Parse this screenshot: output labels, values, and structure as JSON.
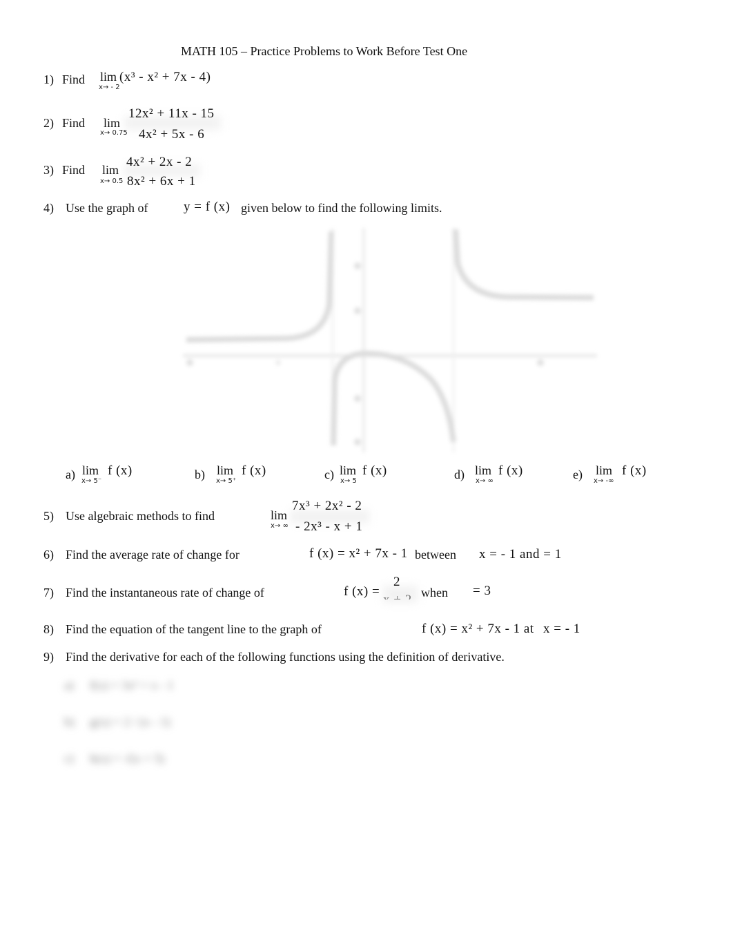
{
  "title": "MATH 105 – Practice Problems to Work Before Test One",
  "problems": {
    "p1": {
      "num": "1)",
      "text": "Find",
      "lim": "lim",
      "sub": "x→ - 2",
      "expr": "(x³ -  x² + 7x - 4)"
    },
    "p2": {
      "num": "2)",
      "text": "Find",
      "lim": "lim",
      "sub": "x→ 0.75",
      "numerator": "12x² + 11x - 15",
      "denominator": "4x² + 5x - 6"
    },
    "p3": {
      "num": "3)",
      "text": "Find",
      "lim": "lim",
      "sub": "x→ 0.5",
      "numerator": "4x² + 2x - 2",
      "denominator": "8x² + 6x + 1"
    },
    "p4": {
      "num": "4)",
      "text": "Use the graph of",
      "func": "y =  f (x)",
      "text2": "given below to find the following limits.",
      "parts": [
        {
          "label": "a)",
          "lim": "lim",
          "sub": "x→ 5⁻",
          "expr": "f (x)"
        },
        {
          "label": "b)",
          "lim": "lim",
          "sub": "x→ 5⁺",
          "expr": "f (x)"
        },
        {
          "label": "c)",
          "lim": "lim",
          "sub": "x→ 5",
          "expr": "f (x)"
        },
        {
          "label": "d)",
          "lim": "lim",
          "sub": "x→ ∞",
          "expr": "f (x)"
        },
        {
          "label": "e)",
          "lim": "lim",
          "sub": "x→ -∞",
          "expr": "f (x)"
        }
      ]
    },
    "p5": {
      "num": "5)",
      "text": "Use algebraic methods to find",
      "lim": "lim",
      "sub": "x→ ∞",
      "numerator": "7x³ + 2x² - 2",
      "denominator": "- 2x³ -  x + 1"
    },
    "p6": {
      "num": "6)",
      "text": "Find the average rate of change for",
      "func": "f (x) =  x² + 7x - 1",
      "between": "between",
      "range": "x = - 1 and    = 1"
    },
    "p7": {
      "num": "7)",
      "text": "Find the instantaneous rate of change of",
      "func": "f (x) =",
      "numerator": "2",
      "denominator": "x + 2",
      "when": "when",
      "value": "=  3"
    },
    "p8": {
      "num": "8)",
      "text": "Find the equation of the tangent line to the graph of",
      "func": "f (x) =  x² + 7x - 1 at",
      "at": "x = - 1"
    },
    "p9": {
      "num": "9)",
      "text": "Find the derivative for each of the following functions using the definition of derivative.",
      "parts": [
        {
          "label": "a)",
          "expr": "f(x) = 3x² + x - 1"
        },
        {
          "label": "b)",
          "expr": "g(x) = 2 / (x - 1)"
        },
        {
          "label": "c)",
          "expr": "h(x) = √(x + 5)"
        }
      ]
    }
  }
}
